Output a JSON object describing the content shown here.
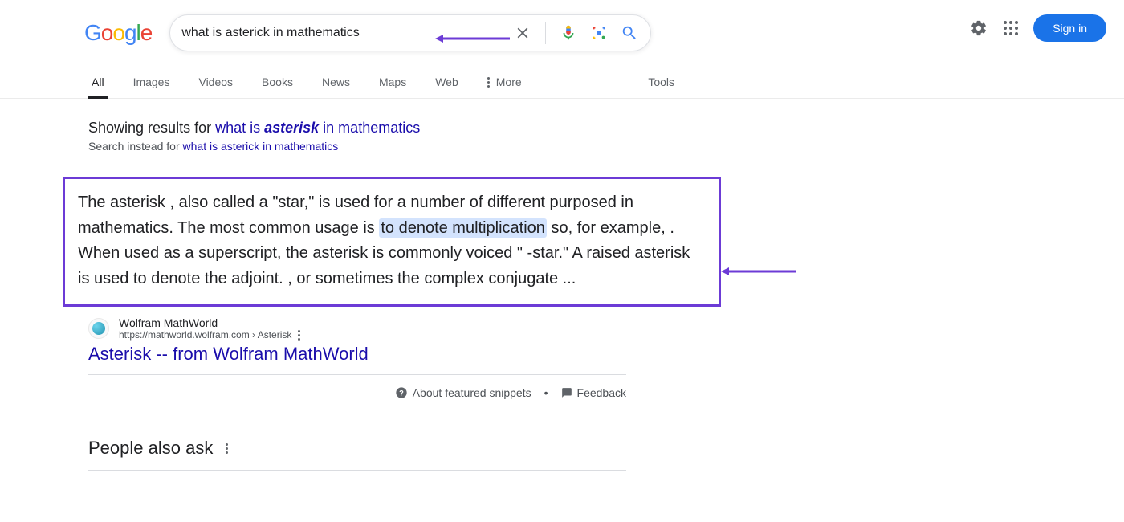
{
  "searchQuery": "what is asterick in mathematics",
  "signin": "Sign in",
  "nav": {
    "all": "All",
    "images": "Images",
    "videos": "Videos",
    "books": "Books",
    "news": "News",
    "maps": "Maps",
    "web": "Web",
    "more": "More",
    "tools": "Tools"
  },
  "spellcheck": {
    "showingLabel": "Showing results for ",
    "correctedPrefix": "what is ",
    "correctedEm": "asterisk",
    "correctedSuffix": " in mathematics",
    "insteadLabel": "Search instead for ",
    "originalQuery": "what is asterick in mathematics"
  },
  "snippet": {
    "part1": "The asterisk , also called a \"star,\" is used for a number of different purposed in mathematics. The most common usage is ",
    "highlight": "to denote multiplication",
    "part2": " so, for example, . When used as a superscript, the asterisk is commonly voiced \" -star.\" A raised asterisk is used to denote the adjoint. , or sometimes the complex conjugate ..."
  },
  "source": {
    "name": "Wolfram MathWorld",
    "url": "https://mathworld.wolfram.com › Asterisk",
    "title": "Asterisk -- from Wolfram MathWorld"
  },
  "footer": {
    "about": "About featured snippets",
    "feedback": "Feedback"
  },
  "paa": "People also ask"
}
